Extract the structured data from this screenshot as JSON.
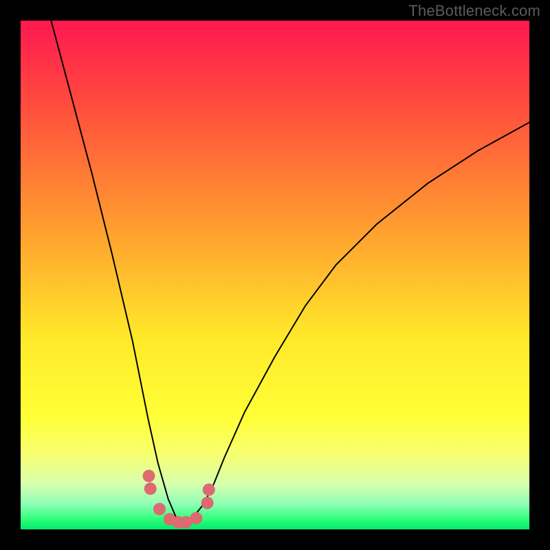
{
  "watermark": "TheBottleneck.com",
  "chart_data": {
    "type": "line",
    "title": "",
    "xlabel": "",
    "ylabel": "",
    "xlim": [
      0,
      100
    ],
    "ylim": [
      0,
      100
    ],
    "series": [
      {
        "name": "bottleneck-curve",
        "x": [
          6,
          10,
          14,
          18,
          22,
          25,
          27,
          29,
          30.5,
          31.5,
          32.5,
          34,
          36,
          38,
          40,
          44,
          50,
          56,
          62,
          70,
          80,
          90,
          100
        ],
        "values": [
          100,
          85,
          70,
          54,
          37,
          22,
          13,
          6,
          2.5,
          1.5,
          1.5,
          2.5,
          5,
          9,
          14,
          23,
          34,
          44,
          52,
          60,
          68,
          74.5,
          80
        ]
      },
      {
        "name": "markers",
        "x": [
          25.2,
          25.5,
          27.3,
          29.3,
          31,
          32.5,
          34.5,
          36.7,
          37
        ],
        "values": [
          10.5,
          8,
          4,
          2,
          1.4,
          1.4,
          2.2,
          5.2,
          7.8
        ]
      }
    ],
    "colors": {
      "curve": "#000000",
      "marker": "#dd6a70",
      "gradient": [
        "#ff1850",
        "#ffe82a",
        "#00eb6a"
      ]
    }
  }
}
